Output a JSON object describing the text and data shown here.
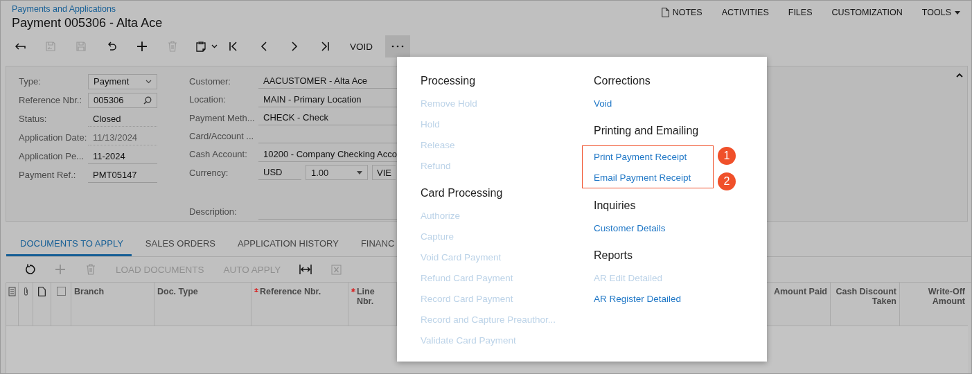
{
  "breadcrumb": "Payments and Applications",
  "title": "Payment 005306 - Alta Ace",
  "top_links": [
    {
      "label": "NOTES",
      "kind": "notes"
    },
    {
      "label": "ACTIVITIES",
      "kind": "plain"
    },
    {
      "label": "FILES",
      "kind": "plain"
    },
    {
      "label": "CUSTOMIZATION",
      "kind": "plain"
    },
    {
      "label": "TOOLS",
      "kind": "dropdown"
    }
  ],
  "toolbar": [
    {
      "kind": "back",
      "disabled": false
    },
    {
      "kind": "save-close",
      "disabled": true
    },
    {
      "kind": "save",
      "disabled": true
    },
    {
      "kind": "undo",
      "disabled": false
    },
    {
      "kind": "add",
      "disabled": false
    },
    {
      "kind": "delete",
      "disabled": true
    },
    {
      "kind": "clipboard",
      "disabled": false
    },
    {
      "kind": "first",
      "disabled": false
    },
    {
      "kind": "prev",
      "disabled": false
    },
    {
      "kind": "next",
      "disabled": false
    },
    {
      "kind": "last",
      "disabled": false
    },
    {
      "kind": "text",
      "label": "VOID",
      "disabled": false
    },
    {
      "kind": "more",
      "disabled": false
    }
  ],
  "form": {
    "collapsed": false,
    "left_fields": [
      {
        "label": "Type:",
        "value": "Payment",
        "kind": "select",
        "disabled": false
      },
      {
        "label": "Reference Nbr.:",
        "value": "005306",
        "kind": "lookup",
        "disabled": false
      },
      {
        "label": "Status:",
        "value": "Closed",
        "kind": "readonly",
        "disabled": false
      },
      {
        "label": "Application Date:",
        "value": "11/13/2024",
        "kind": "readonly",
        "disabled": true
      },
      {
        "label": "Application Pe...",
        "value": "11-2024",
        "kind": "text",
        "disabled": false
      },
      {
        "label": "Payment Ref.:",
        "value": "PMT05147",
        "kind": "text",
        "disabled": false
      }
    ],
    "right_fields": [
      {
        "label": "Customer:",
        "value": "AACUSTOMER - Alta Ace",
        "kind": "text"
      },
      {
        "label": "Location:",
        "value": "MAIN - Primary Location",
        "kind": "text"
      },
      {
        "label": "Payment Meth...",
        "value": "CHECK - Check",
        "kind": "text"
      },
      {
        "label": "Card/Account ...",
        "kind": "text"
      },
      {
        "label": "Cash Account:",
        "value": "10200 - Company Checking Acco",
        "kind": "text"
      },
      {
        "label": "Currency:",
        "value": "USD",
        "rate": "1.00",
        "button": "VIE",
        "kind": "currency"
      },
      {
        "label": "Description:",
        "kind": "description"
      }
    ]
  },
  "tabs": [
    {
      "label": "DOCUMENTS TO APPLY",
      "selected": true
    },
    {
      "label": "SALES ORDERS",
      "selected": false
    },
    {
      "label": "APPLICATION HISTORY",
      "selected": false
    },
    {
      "label": "FINANC",
      "selected": false
    }
  ],
  "grid_toolbar": [
    {
      "kind": "refresh",
      "disabled": false
    },
    {
      "kind": "add",
      "disabled": true
    },
    {
      "kind": "delete",
      "disabled": true
    },
    {
      "kind": "text",
      "label": "LOAD DOCUMENTS",
      "disabled": true
    },
    {
      "kind": "text",
      "label": "AUTO APPLY",
      "disabled": true
    },
    {
      "kind": "fit",
      "disabled": false
    },
    {
      "kind": "excel",
      "disabled": true
    }
  ],
  "grid": {
    "columns": [
      {
        "kind": "files-icon"
      },
      {
        "kind": "attach-icon"
      },
      {
        "kind": "note-icon"
      },
      {
        "kind": "select-all",
        "checked": false
      },
      {
        "kind": "text",
        "label": "Branch",
        "required": false
      },
      {
        "kind": "text",
        "label": "Doc. Type",
        "required": false
      },
      {
        "kind": "text",
        "label": "Reference Nbr.",
        "required": true
      },
      {
        "kind": "text",
        "label": "Line Nbr.",
        "required": true
      },
      {
        "kind": "hidden"
      },
      {
        "kind": "number",
        "label": "Amount Paid",
        "required": false
      },
      {
        "kind": "number",
        "label": "Cash Discount Taken",
        "required": false
      },
      {
        "kind": "number",
        "label": "Write-Off Amount",
        "required": false
      }
    ]
  },
  "more_menu": {
    "open": true,
    "columns": [
      [
        {
          "heading": "Processing",
          "items": [
            {
              "label": "Remove Hold",
              "disabled": true
            },
            {
              "label": "Hold",
              "disabled": true
            },
            {
              "label": "Release",
              "disabled": true
            },
            {
              "label": "Refund",
              "disabled": true
            }
          ]
        },
        {
          "heading": "Card Processing",
          "items": [
            {
              "label": "Authorize",
              "disabled": true
            },
            {
              "label": "Capture",
              "disabled": true
            },
            {
              "label": "Void Card Payment",
              "disabled": true
            },
            {
              "label": "Refund Card Payment",
              "disabled": true
            },
            {
              "label": "Record Card Payment",
              "disabled": true
            },
            {
              "label": "Record and Capture Preauthor...",
              "disabled": true
            },
            {
              "label": "Validate Card Payment",
              "disabled": true
            }
          ]
        }
      ],
      [
        {
          "heading": "Corrections",
          "items": [
            {
              "label": "Void",
              "disabled": false
            }
          ]
        },
        {
          "heading": "Printing and Emailing",
          "items": [
            {
              "label": "Print Payment Receipt",
              "disabled": false,
              "callout": "1"
            },
            {
              "label": "Email Payment Receipt",
              "disabled": false,
              "callout": "2"
            }
          ]
        },
        {
          "heading": "Inquiries",
          "items": [
            {
              "label": "Customer Details",
              "disabled": false
            }
          ]
        },
        {
          "heading": "Reports",
          "items": [
            {
              "label": "AR Edit Detailed",
              "disabled": true
            },
            {
              "label": "AR Register Detailed",
              "disabled": false
            }
          ]
        }
      ]
    ]
  }
}
